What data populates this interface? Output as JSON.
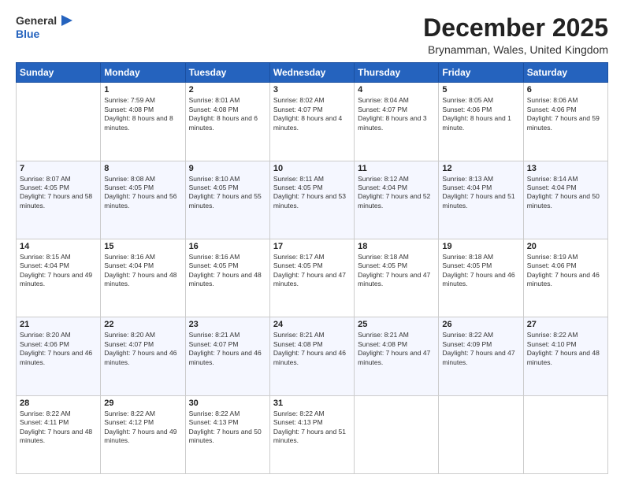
{
  "header": {
    "logo_general": "General",
    "logo_blue": "Blue",
    "month_year": "December 2025",
    "location": "Brynamman, Wales, United Kingdom"
  },
  "weekdays": [
    "Sunday",
    "Monday",
    "Tuesday",
    "Wednesday",
    "Thursday",
    "Friday",
    "Saturday"
  ],
  "weeks": [
    [
      {
        "day": "",
        "sunrise": "",
        "sunset": "",
        "daylight": ""
      },
      {
        "day": "1",
        "sunrise": "Sunrise: 7:59 AM",
        "sunset": "Sunset: 4:08 PM",
        "daylight": "Daylight: 8 hours and 8 minutes."
      },
      {
        "day": "2",
        "sunrise": "Sunrise: 8:01 AM",
        "sunset": "Sunset: 4:08 PM",
        "daylight": "Daylight: 8 hours and 6 minutes."
      },
      {
        "day": "3",
        "sunrise": "Sunrise: 8:02 AM",
        "sunset": "Sunset: 4:07 PM",
        "daylight": "Daylight: 8 hours and 4 minutes."
      },
      {
        "day": "4",
        "sunrise": "Sunrise: 8:04 AM",
        "sunset": "Sunset: 4:07 PM",
        "daylight": "Daylight: 8 hours and 3 minutes."
      },
      {
        "day": "5",
        "sunrise": "Sunrise: 8:05 AM",
        "sunset": "Sunset: 4:06 PM",
        "daylight": "Daylight: 8 hours and 1 minute."
      },
      {
        "day": "6",
        "sunrise": "Sunrise: 8:06 AM",
        "sunset": "Sunset: 4:06 PM",
        "daylight": "Daylight: 7 hours and 59 minutes."
      }
    ],
    [
      {
        "day": "7",
        "sunrise": "Sunrise: 8:07 AM",
        "sunset": "Sunset: 4:05 PM",
        "daylight": "Daylight: 7 hours and 58 minutes."
      },
      {
        "day": "8",
        "sunrise": "Sunrise: 8:08 AM",
        "sunset": "Sunset: 4:05 PM",
        "daylight": "Daylight: 7 hours and 56 minutes."
      },
      {
        "day": "9",
        "sunrise": "Sunrise: 8:10 AM",
        "sunset": "Sunset: 4:05 PM",
        "daylight": "Daylight: 7 hours and 55 minutes."
      },
      {
        "day": "10",
        "sunrise": "Sunrise: 8:11 AM",
        "sunset": "Sunset: 4:05 PM",
        "daylight": "Daylight: 7 hours and 53 minutes."
      },
      {
        "day": "11",
        "sunrise": "Sunrise: 8:12 AM",
        "sunset": "Sunset: 4:04 PM",
        "daylight": "Daylight: 7 hours and 52 minutes."
      },
      {
        "day": "12",
        "sunrise": "Sunrise: 8:13 AM",
        "sunset": "Sunset: 4:04 PM",
        "daylight": "Daylight: 7 hours and 51 minutes."
      },
      {
        "day": "13",
        "sunrise": "Sunrise: 8:14 AM",
        "sunset": "Sunset: 4:04 PM",
        "daylight": "Daylight: 7 hours and 50 minutes."
      }
    ],
    [
      {
        "day": "14",
        "sunrise": "Sunrise: 8:15 AM",
        "sunset": "Sunset: 4:04 PM",
        "daylight": "Daylight: 7 hours and 49 minutes."
      },
      {
        "day": "15",
        "sunrise": "Sunrise: 8:16 AM",
        "sunset": "Sunset: 4:04 PM",
        "daylight": "Daylight: 7 hours and 48 minutes."
      },
      {
        "day": "16",
        "sunrise": "Sunrise: 8:16 AM",
        "sunset": "Sunset: 4:05 PM",
        "daylight": "Daylight: 7 hours and 48 minutes."
      },
      {
        "day": "17",
        "sunrise": "Sunrise: 8:17 AM",
        "sunset": "Sunset: 4:05 PM",
        "daylight": "Daylight: 7 hours and 47 minutes."
      },
      {
        "day": "18",
        "sunrise": "Sunrise: 8:18 AM",
        "sunset": "Sunset: 4:05 PM",
        "daylight": "Daylight: 7 hours and 47 minutes."
      },
      {
        "day": "19",
        "sunrise": "Sunrise: 8:18 AM",
        "sunset": "Sunset: 4:05 PM",
        "daylight": "Daylight: 7 hours and 46 minutes."
      },
      {
        "day": "20",
        "sunrise": "Sunrise: 8:19 AM",
        "sunset": "Sunset: 4:06 PM",
        "daylight": "Daylight: 7 hours and 46 minutes."
      }
    ],
    [
      {
        "day": "21",
        "sunrise": "Sunrise: 8:20 AM",
        "sunset": "Sunset: 4:06 PM",
        "daylight": "Daylight: 7 hours and 46 minutes."
      },
      {
        "day": "22",
        "sunrise": "Sunrise: 8:20 AM",
        "sunset": "Sunset: 4:07 PM",
        "daylight": "Daylight: 7 hours and 46 minutes."
      },
      {
        "day": "23",
        "sunrise": "Sunrise: 8:21 AM",
        "sunset": "Sunset: 4:07 PM",
        "daylight": "Daylight: 7 hours and 46 minutes."
      },
      {
        "day": "24",
        "sunrise": "Sunrise: 8:21 AM",
        "sunset": "Sunset: 4:08 PM",
        "daylight": "Daylight: 7 hours and 46 minutes."
      },
      {
        "day": "25",
        "sunrise": "Sunrise: 8:21 AM",
        "sunset": "Sunset: 4:08 PM",
        "daylight": "Daylight: 7 hours and 47 minutes."
      },
      {
        "day": "26",
        "sunrise": "Sunrise: 8:22 AM",
        "sunset": "Sunset: 4:09 PM",
        "daylight": "Daylight: 7 hours and 47 minutes."
      },
      {
        "day": "27",
        "sunrise": "Sunrise: 8:22 AM",
        "sunset": "Sunset: 4:10 PM",
        "daylight": "Daylight: 7 hours and 48 minutes."
      }
    ],
    [
      {
        "day": "28",
        "sunrise": "Sunrise: 8:22 AM",
        "sunset": "Sunset: 4:11 PM",
        "daylight": "Daylight: 7 hours and 48 minutes."
      },
      {
        "day": "29",
        "sunrise": "Sunrise: 8:22 AM",
        "sunset": "Sunset: 4:12 PM",
        "daylight": "Daylight: 7 hours and 49 minutes."
      },
      {
        "day": "30",
        "sunrise": "Sunrise: 8:22 AM",
        "sunset": "Sunset: 4:13 PM",
        "daylight": "Daylight: 7 hours and 50 minutes."
      },
      {
        "day": "31",
        "sunrise": "Sunrise: 8:22 AM",
        "sunset": "Sunset: 4:13 PM",
        "daylight": "Daylight: 7 hours and 51 minutes."
      },
      {
        "day": "",
        "sunrise": "",
        "sunset": "",
        "daylight": ""
      },
      {
        "day": "",
        "sunrise": "",
        "sunset": "",
        "daylight": ""
      },
      {
        "day": "",
        "sunrise": "",
        "sunset": "",
        "daylight": ""
      }
    ]
  ]
}
